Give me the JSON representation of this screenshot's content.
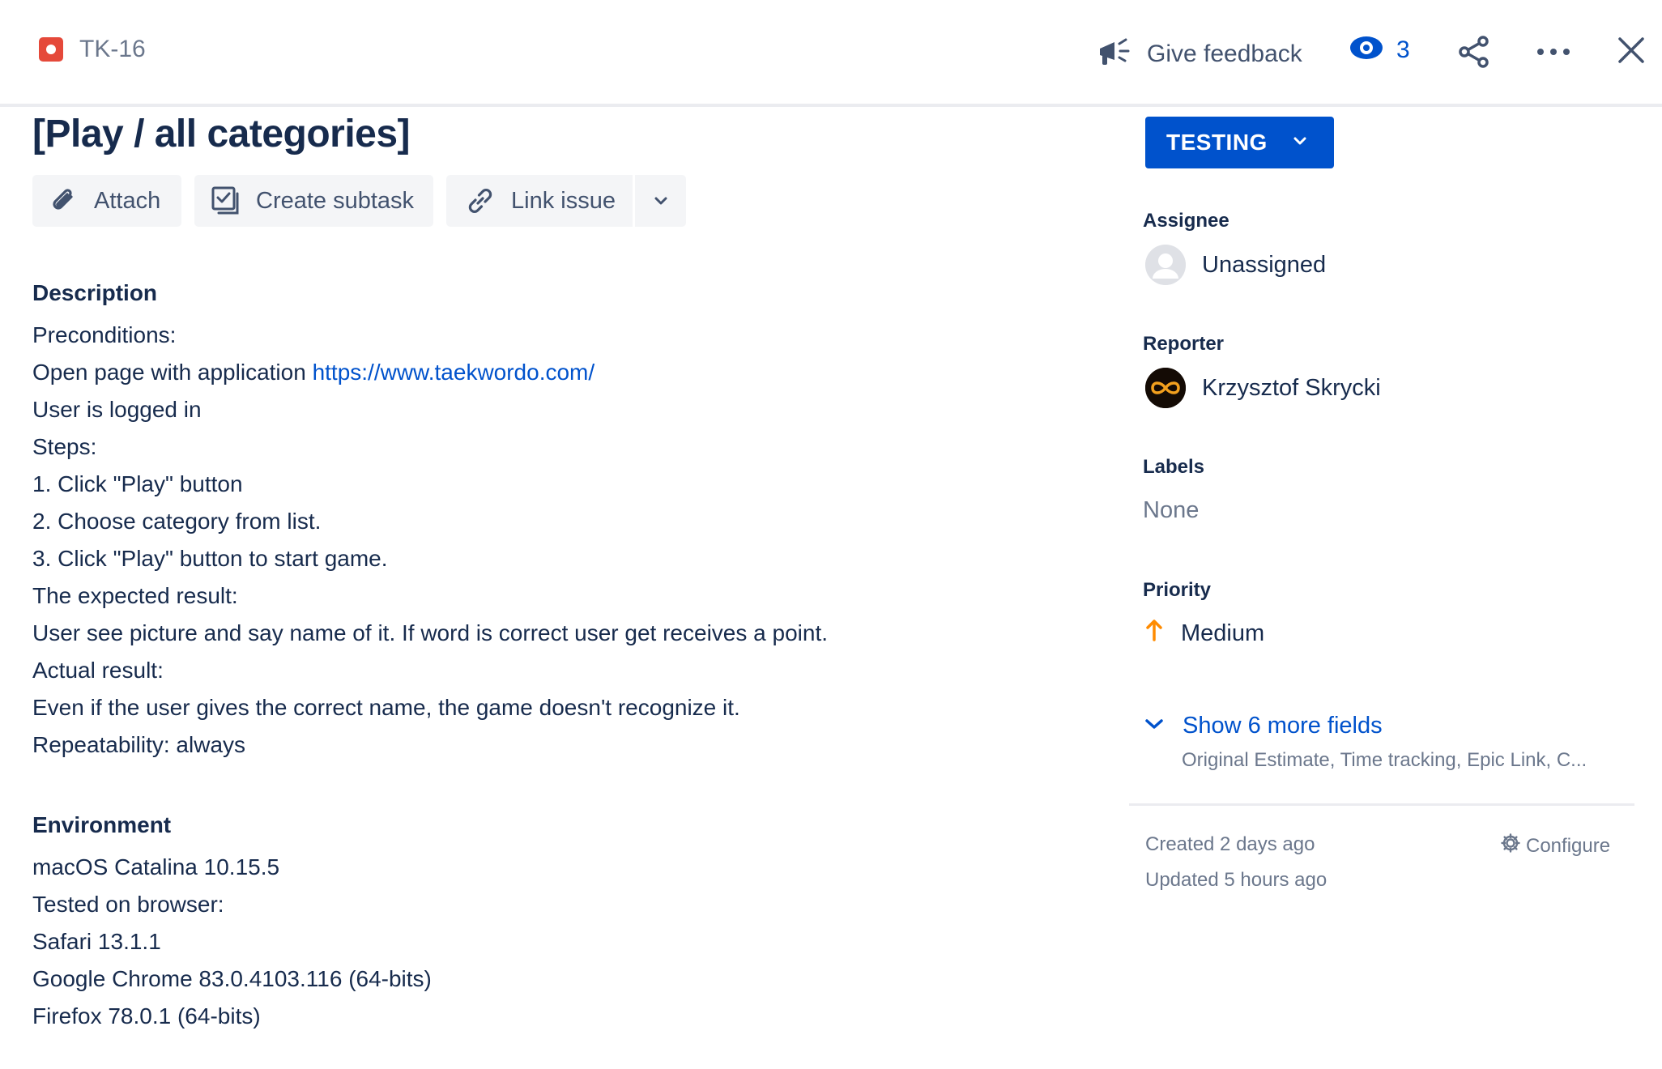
{
  "header": {
    "issue_key": "TK-16",
    "feedback_label": "Give feedback",
    "watch_count": "3"
  },
  "issue": {
    "title": "[Play / all categories]"
  },
  "toolbar": {
    "attach_label": "Attach",
    "create_subtask_label": "Create subtask",
    "link_issue_label": "Link issue"
  },
  "description": {
    "heading": "Description",
    "lines": [
      "Preconditions:",
      "Open page with application ",
      "User is logged in",
      "Steps:",
      "1. Click \"Play\" button",
      "2. Choose category from list.",
      "3. Click \"Play\" button to start game.",
      "The expected result:",
      "User see picture and say name of it. If word is correct user get receives a point.",
      "Actual result:",
      "Even if the user gives the correct name, the game doesn't recognize it.",
      "Repeatability: always"
    ],
    "link_text": "https://www.taekwordo.com/"
  },
  "environment": {
    "heading": "Environment",
    "lines": [
      "macOS Catalina 10.15.5",
      "Tested on browser:",
      "Safari 13.1.1",
      "Google Chrome 83.0.4103.116 (64-bits)",
      "Firefox 78.0.1 (64-bits)"
    ]
  },
  "sidebar": {
    "status": "TESTING",
    "assignee": {
      "label": "Assignee",
      "value": "Unassigned"
    },
    "reporter": {
      "label": "Reporter",
      "value": "Krzysztof Skrycki"
    },
    "labels": {
      "label": "Labels",
      "value": "None"
    },
    "priority": {
      "label": "Priority",
      "value": "Medium",
      "color": "#FF8B00"
    },
    "show_more": {
      "label": "Show 6 more fields",
      "sub": "Original Estimate, Time tracking, Epic Link, C..."
    },
    "created": "Created 2 days ago",
    "updated": "Updated 5 hours ago",
    "configure_label": "Configure"
  },
  "colors": {
    "accent": "#0052CC",
    "bug": "#E5493A",
    "text": "#172B4D",
    "subtle": "#6B778C"
  }
}
